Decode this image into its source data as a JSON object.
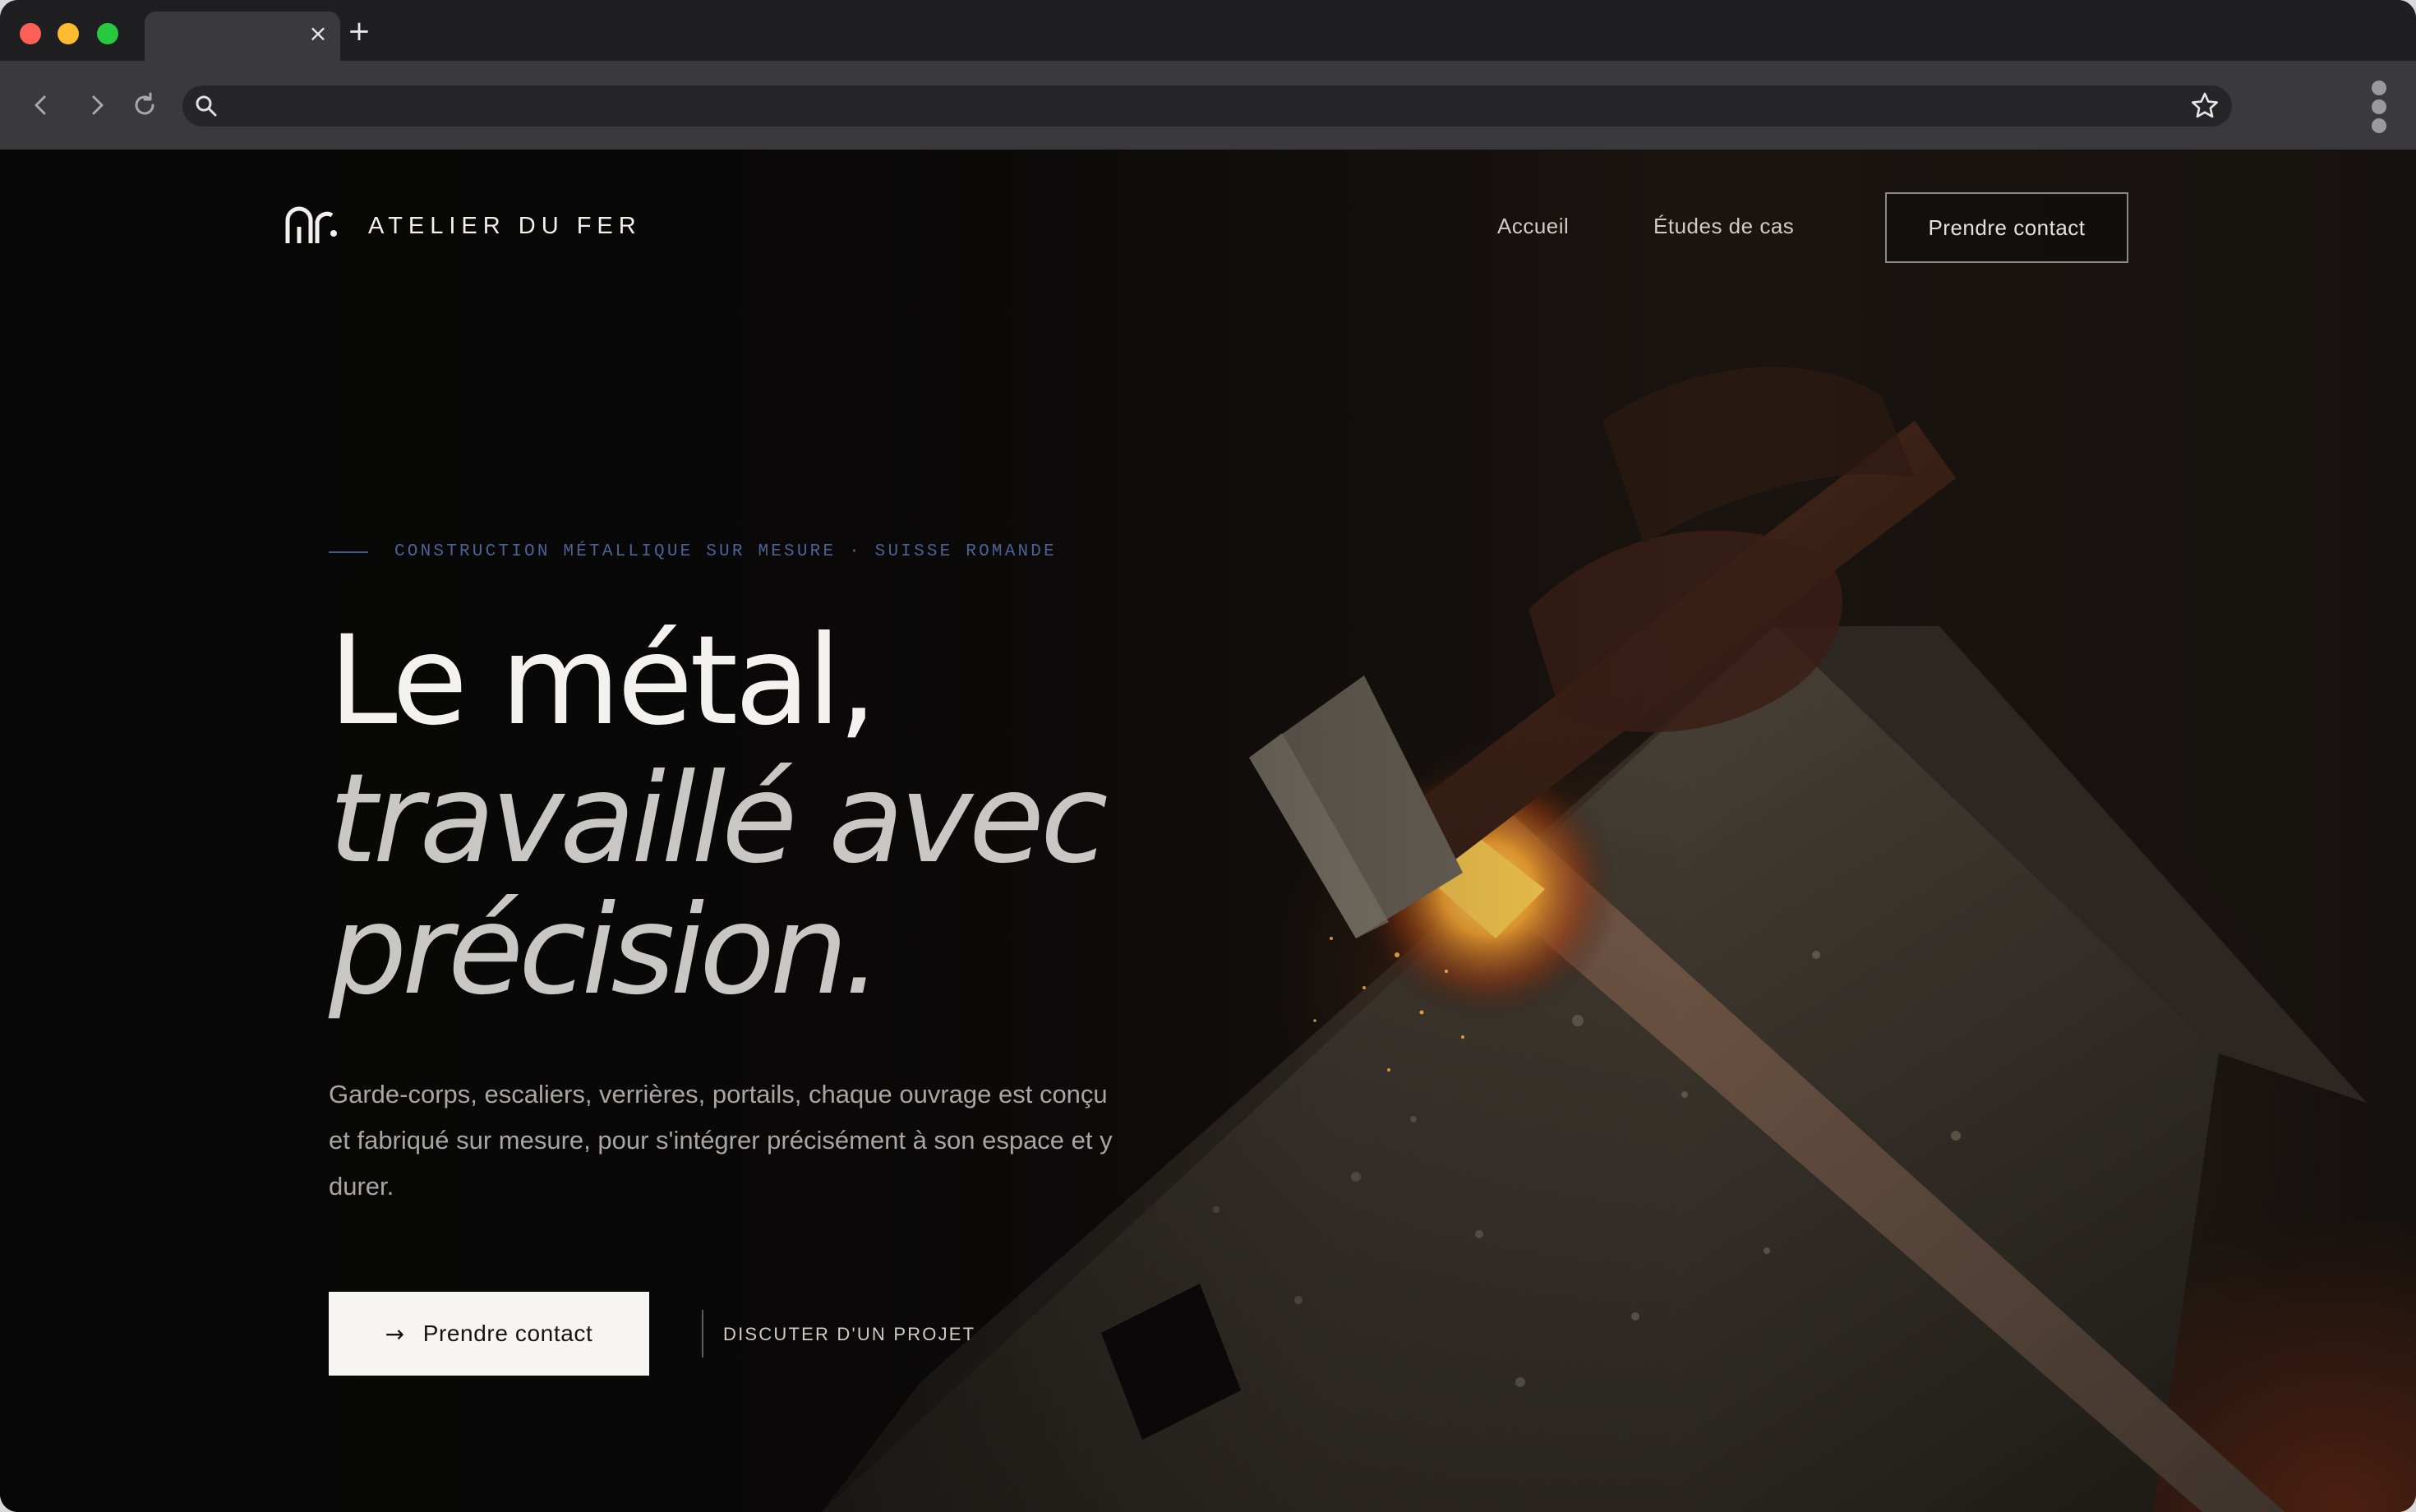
{
  "browser": {
    "tab_close": "×",
    "new_tab": "+",
    "address_value": ""
  },
  "site": {
    "brand": "ATELIER DU FER",
    "nav": {
      "home": "Accueil",
      "cases": "Études de cas",
      "contact": "Prendre contact"
    }
  },
  "hero": {
    "eyebrow": "CONSTRUCTION MÉTALLIQUE SUR MESURE · SUISSE ROMANDE",
    "headline_line1": "Le métal,",
    "headline_line2": "travaillé avec",
    "headline_line3": "précision.",
    "lede": "Garde-corps, escaliers, verrières, portails, chaque ouvrage est conçu et fabriqué sur mesure, pour s'intégrer précisément à son espace et y durer.",
    "cta_primary_arrow": "→",
    "cta_primary_label": "Prendre contact",
    "cta_secondary_label": "DISCUTER D'UN PROJET"
  },
  "colors": {
    "accent_eyebrow": "#4b6393",
    "cta_bg": "#f6f5f2",
    "chrome_dark": "#1f1f22",
    "chrome_toolbar": "#3a3a3e"
  },
  "icons": [
    "back-icon",
    "forward-icon",
    "reload-icon",
    "search-icon",
    "star-icon",
    "menu-dots-icon",
    "logo-mark"
  ]
}
